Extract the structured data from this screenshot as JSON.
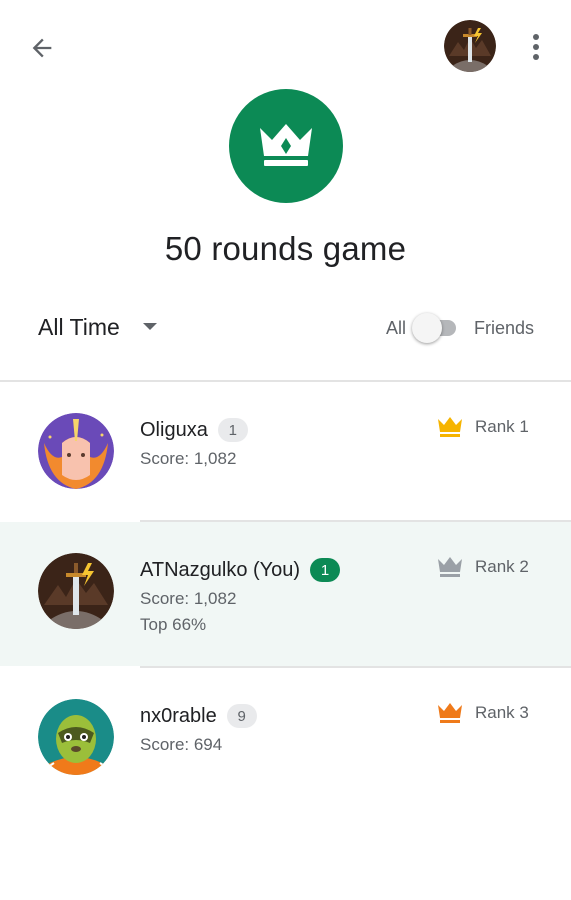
{
  "header": {
    "back_icon": "arrow-back-icon",
    "more_icon": "more-vert-icon"
  },
  "game": {
    "title": "50 rounds game",
    "badge_icon": "crown-icon",
    "badge_color": "#0c8a55"
  },
  "filters": {
    "time_range": "All Time",
    "toggle_left": "All",
    "toggle_right": "Friends",
    "toggle_friends_on": false
  },
  "leaderboard": [
    {
      "name": "Oliguxa",
      "level": "1",
      "score": "Score: 1,082",
      "extra": "",
      "rank": "Rank 1",
      "crown_color": "#f6b400",
      "avatar": "unicorn-avatar",
      "is_you": false
    },
    {
      "name": "ATNazgulko (You)",
      "level": "1",
      "score": "Score: 1,082",
      "extra": "Top 66%",
      "rank": "Rank 2",
      "crown_color": "#9aa0a6",
      "avatar": "sword-avatar",
      "is_you": true
    },
    {
      "name": "nx0rable",
      "level": "9",
      "score": "Score: 694",
      "extra": "",
      "rank": "Rank 3",
      "crown_color": "#ef7a1a",
      "avatar": "sloth-avatar",
      "is_you": false
    }
  ]
}
